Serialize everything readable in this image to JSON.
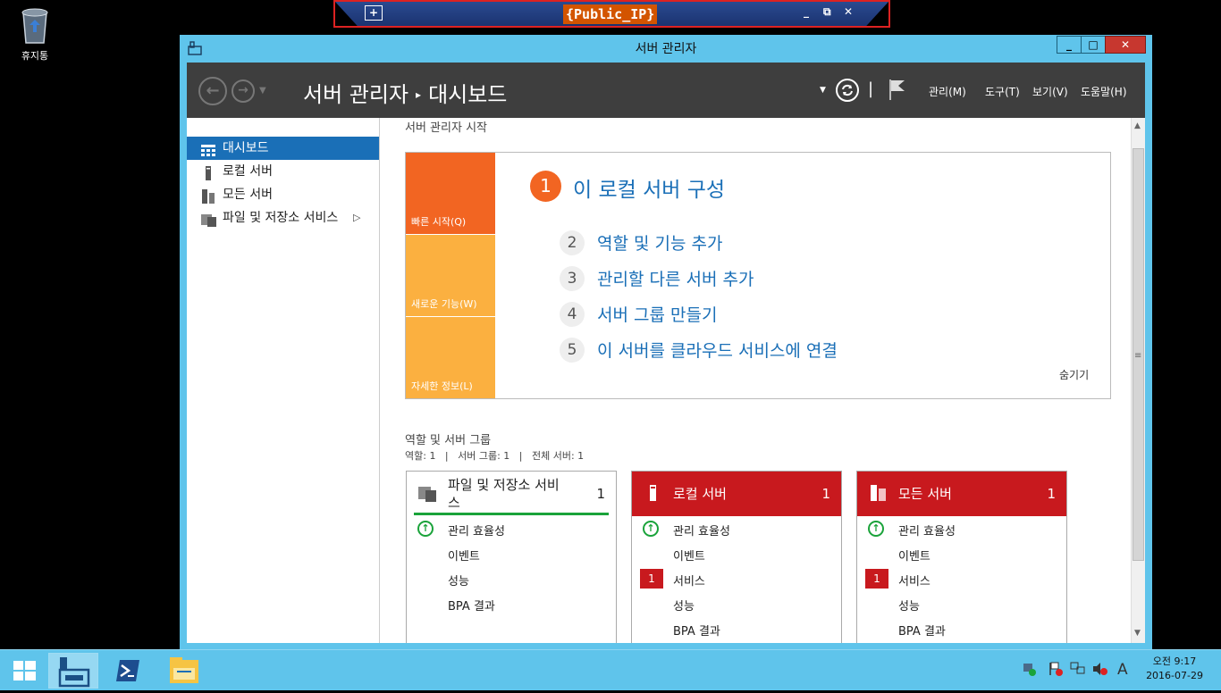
{
  "desktop": {
    "recycle_bin_label": "휴지통"
  },
  "rdp": {
    "title": "{Public_IP}",
    "pin": "+",
    "minimize": "_",
    "restore": "⧉",
    "close": "✕"
  },
  "window": {
    "title": "서버 관리자",
    "controls": {
      "minimize": "_",
      "maximize": "□",
      "close": "✕"
    }
  },
  "header": {
    "breadcrumb_root": "서버 관리자",
    "breadcrumb_sep": "▸",
    "breadcrumb_page": "대시보드",
    "menus": [
      "관리(M)",
      "도구(T)",
      "보기(V)",
      "도움말(H)"
    ],
    "pipe": "|"
  },
  "nav": {
    "items": [
      {
        "label": "대시보드",
        "active": true
      },
      {
        "label": "로컬 서버"
      },
      {
        "label": "모든 서버"
      },
      {
        "label": "파일 및 저장소 서비스",
        "chevron": "▷"
      }
    ]
  },
  "quickstart": {
    "section_title": "서버 관리자 시작",
    "tiles": [
      "빠른 시작(Q)",
      "새로운 기능(W)",
      "자세한 정보(L)"
    ],
    "step1": {
      "num": "1",
      "label": "이 로컬 서버 구성"
    },
    "steps": [
      {
        "num": "2",
        "label": "역할 및 기능 추가"
      },
      {
        "num": "3",
        "label": "관리할 다른 서버 추가"
      },
      {
        "num": "4",
        "label": "서버 그룹 만들기"
      },
      {
        "num": "5",
        "label": "이 서버를 클라우드 서비스에 연결"
      }
    ],
    "hide": "숨기기"
  },
  "roles": {
    "section_title": "역할 및 서버 그룹",
    "summary": "역할: 1   |   서버 그룹: 1   |   전체 서버: 1",
    "cards": [
      {
        "title_line1": "파일 및 저장소 서비",
        "title_line2": "스",
        "count": "1",
        "rows": [
          "관리 효율성",
          "이벤트",
          "성능",
          "BPA 결과"
        ]
      },
      {
        "title": "로컬 서버",
        "count": "1",
        "service_badge": "1",
        "rows": [
          "관리 효율성",
          "이벤트",
          "서비스",
          "성능",
          "BPA 결과"
        ]
      },
      {
        "title": "모든 서버",
        "count": "1",
        "service_badge": "1",
        "rows": [
          "관리 효율성",
          "이벤트",
          "서비스",
          "성능",
          "BPA 결과"
        ]
      }
    ]
  },
  "taskbar": {
    "clock_line1": "오전 9:17",
    "clock_line2": "2016-07-29",
    "ime": "A"
  },
  "colors": {
    "accent": "#1a6fb7",
    "orange": "#f26522",
    "amber": "#fbb040",
    "red": "#c8191e",
    "window": "#5fc4eb"
  }
}
